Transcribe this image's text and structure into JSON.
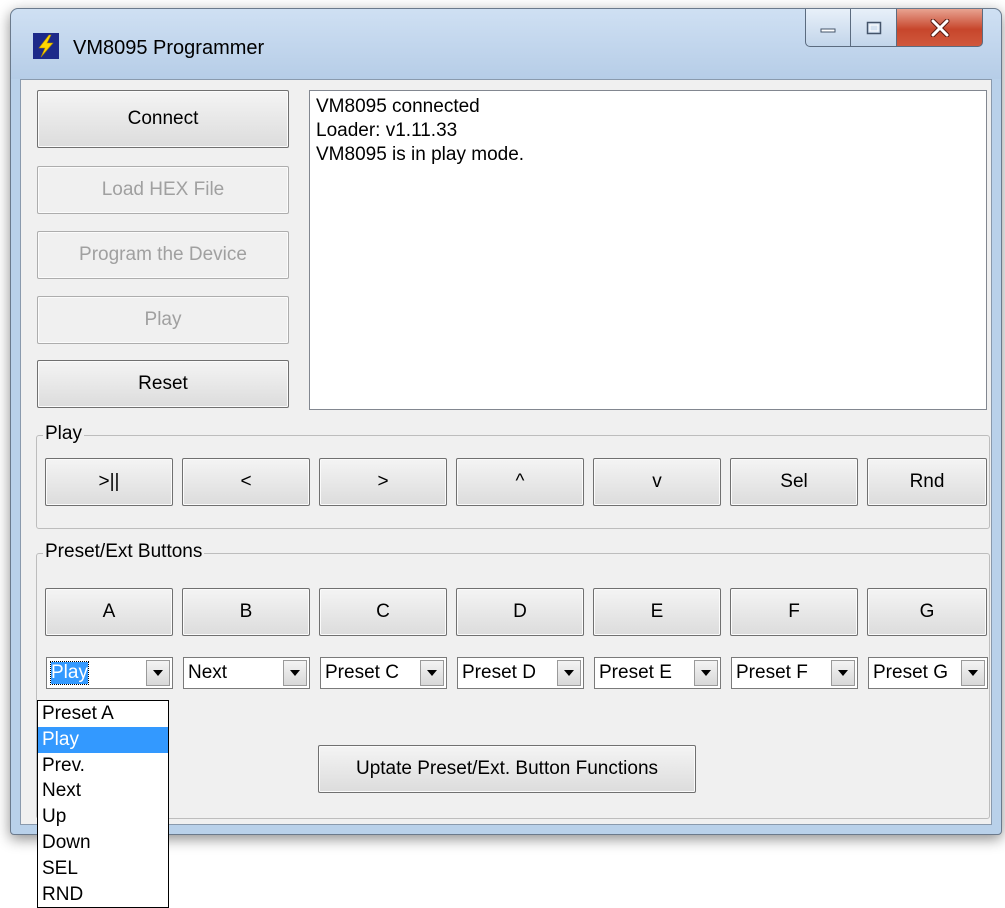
{
  "window": {
    "title": "VM8095 Programmer"
  },
  "left_buttons": {
    "connect": "Connect",
    "load_hex": "Load HEX File",
    "program": "Program the Device",
    "play": "Play",
    "reset": "Reset"
  },
  "log": {
    "lines": "VM8095 connected\nLoader: v1.11.33\nVM8095 is in play mode."
  },
  "play_group": {
    "label": "Play",
    "buttons": [
      ">||",
      "<",
      ">",
      "^",
      "v",
      "Sel",
      "Rnd"
    ]
  },
  "preset_group": {
    "label": "Preset/Ext Buttons",
    "buttons": [
      "A",
      "B",
      "C",
      "D",
      "E",
      "F",
      "G"
    ],
    "combos": [
      "Play",
      "Next",
      "Preset C",
      "Preset D",
      "Preset E",
      "Preset F",
      "Preset G"
    ],
    "update_button": "Uptate Preset/Ext. Button Functions"
  },
  "dropdown": {
    "options": [
      "Preset A",
      "Play",
      "Prev.",
      "Next",
      "Up",
      "Down",
      "SEL",
      "RND"
    ],
    "highlighted": "Play"
  },
  "icons": {
    "app": "lightning-bolt-icon",
    "minimize": "minimize-icon",
    "maximize": "maximize-icon",
    "close": "close-icon"
  },
  "colors": {
    "selection": "#3399ff",
    "close_button": "#c7462c"
  }
}
